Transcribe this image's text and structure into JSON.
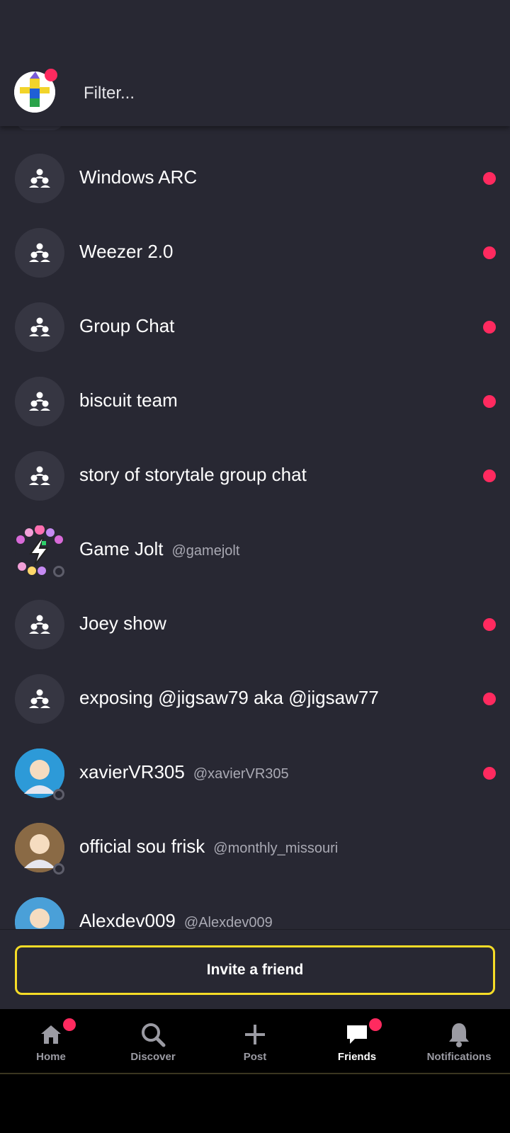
{
  "filter": {
    "placeholder": "Filter..."
  },
  "colors": {
    "background": "#282833",
    "unread": "#ff2a5f",
    "invite_border": "#f5dc27"
  },
  "chats": [
    {
      "name": "Windows ARC",
      "handle": "",
      "avatar": "group-icon",
      "unread": true
    },
    {
      "name": "Weezer 2.0",
      "handle": "",
      "avatar": "group-icon",
      "unread": true
    },
    {
      "name": "Group Chat",
      "handle": "",
      "avatar": "group-icon",
      "unread": true
    },
    {
      "name": "biscuit team",
      "handle": "",
      "avatar": "group-icon",
      "unread": true
    },
    {
      "name": "story of storytale group chat",
      "handle": "",
      "avatar": "group-icon",
      "unread": true
    },
    {
      "name": "Game Jolt",
      "handle": "@gamejolt",
      "avatar": "gamejolt-avatar",
      "unread": false
    },
    {
      "name": "Joey show",
      "handle": "",
      "avatar": "group-icon",
      "unread": true
    },
    {
      "name": "exposing @jigsaw79 aka @jigsaw77",
      "handle": "",
      "avatar": "group-icon",
      "unread": true
    },
    {
      "name": "xavierVR305",
      "handle": "@xavierVR305",
      "avatar": "user-avatar",
      "unread": true
    },
    {
      "name": "official sou frisk",
      "handle": "@monthly_missouri",
      "avatar": "user-avatar",
      "unread": false
    },
    {
      "name": "Alexdev009",
      "handle": "@Alexdev009",
      "avatar": "user-avatar",
      "unread": false
    }
  ],
  "invite": {
    "label": "Invite a friend"
  },
  "nav": {
    "home": "Home",
    "discover": "Discover",
    "post": "Post",
    "friends": "Friends",
    "notifications": "Notifications"
  }
}
